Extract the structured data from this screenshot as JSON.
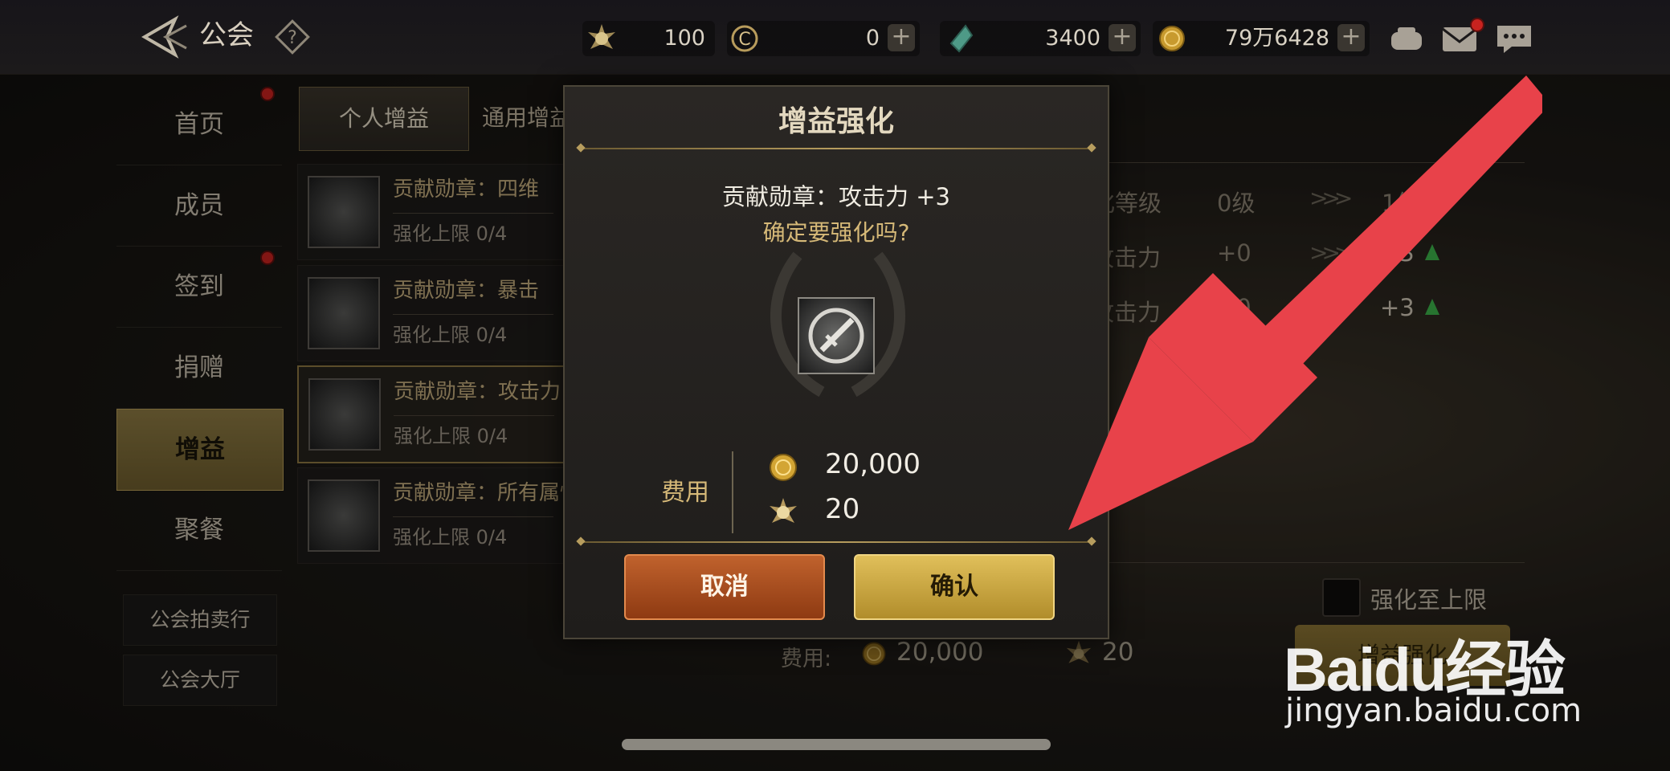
{
  "header": {
    "title": "公会",
    "resources": [
      {
        "icon": "star-medal-icon",
        "value": "100"
      },
      {
        "icon": "c-coin-icon",
        "value": "0"
      },
      {
        "icon": "green-crystal-icon",
        "value": "3400"
      },
      {
        "icon": "gold-coin-icon",
        "value": "79万6428"
      }
    ],
    "plus": "+"
  },
  "sidebar": {
    "items": [
      {
        "label": "首页",
        "badge": true
      },
      {
        "label": "成员",
        "badge": false
      },
      {
        "label": "签到",
        "badge": true
      },
      {
        "label": "捐赠",
        "badge": false
      },
      {
        "label": "增益",
        "badge": false,
        "active": true
      },
      {
        "label": "聚餐",
        "badge": false
      }
    ],
    "sub_buttons": [
      "公会拍卖行",
      "公会大厅"
    ]
  },
  "tabs": [
    "个人增益",
    "通用增益"
  ],
  "buff_list": [
    {
      "name": "贡献勋章：四维",
      "limit": "强化上限 0/4"
    },
    {
      "name": "贡献勋章：暴击",
      "limit": "强化上限 0/4"
    },
    {
      "name": "贡献勋章：攻击力",
      "limit": "强化上限 0/4"
    },
    {
      "name": "贡献勋章：所有属性强化",
      "limit": "强化上限 0/4"
    }
  ],
  "detail": {
    "rows": [
      {
        "label": "强化等级",
        "current": "0级",
        "next": "1级"
      },
      {
        "label": "物理攻击力",
        "current": "+0",
        "next": "+3"
      },
      {
        "label": "魔法攻击力",
        "current": "+0",
        "next": "+3"
      }
    ],
    "checkbox_label": "强化至上限",
    "cost_label": "费用:",
    "cost_gold": "20,000",
    "cost_medal": "20",
    "enhance_button": "增益强化"
  },
  "dialog": {
    "title": "增益强化",
    "item_line": "贡献勋章：攻击力 +3",
    "question": "确定要强化吗?",
    "cost_label": "费用",
    "costs": [
      {
        "icon": "gold-coin-icon",
        "value": "20,000"
      },
      {
        "icon": "star-medal-icon",
        "value": "20"
      }
    ],
    "cancel_label": "取消",
    "confirm_label": "确认"
  },
  "watermark": {
    "logo": "Baidu经验",
    "site": "jingyan.baidu.com"
  },
  "colors": {
    "gold": "#b79d5e",
    "arrow": "#e8424a",
    "cancel": "#b5572a",
    "confirm": "#d3b14c"
  }
}
